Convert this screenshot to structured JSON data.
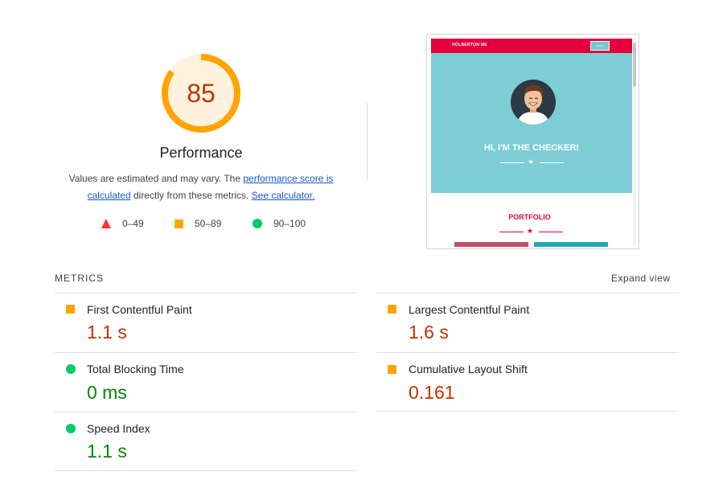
{
  "gauge": {
    "score": "85",
    "score_fraction": 0.85,
    "title": "Performance",
    "color": "#ffa400"
  },
  "note": {
    "text_before": "Values are estimated and may vary. The ",
    "link1": "performance score is calculated",
    "text_mid": " directly from these metrics. ",
    "link2": "See calculator."
  },
  "legend": [
    {
      "icon": "fail-triangle-icon",
      "range": "0–49",
      "color": "#ff3333"
    },
    {
      "icon": "average-square-icon",
      "range": "50–89",
      "color": "#ffa400"
    },
    {
      "icon": "pass-circle-icon",
      "range": "90–100",
      "color": "#00cc66"
    }
  ],
  "screenshot": {
    "brand": "HOLBERTON ME",
    "menu": "MENU",
    "hero_title": "HI, I'M THE CHECKER!",
    "section_title": "PORTFOLIO",
    "nav_color": "#e5003d",
    "hero_color": "#7ccdd4"
  },
  "metrics": {
    "header": "METRICS",
    "expand": "Expand view",
    "items": [
      {
        "label": "First Contentful Paint",
        "value": "1.1 s",
        "status": "average",
        "icon": "average-square-icon"
      },
      {
        "label": "Largest Contentful Paint",
        "value": "1.6 s",
        "status": "average",
        "icon": "average-square-icon"
      },
      {
        "label": "Total Blocking Time",
        "value": "0 ms",
        "status": "pass",
        "icon": "pass-circle-icon"
      },
      {
        "label": "Cumulative Layout Shift",
        "value": "0.161",
        "status": "average",
        "icon": "average-square-icon"
      },
      {
        "label": "Speed Index",
        "value": "1.1 s",
        "status": "pass",
        "icon": "pass-circle-icon"
      }
    ]
  },
  "colors": {
    "average_text": "#c33300",
    "pass_text": "#008800",
    "link": "#1a56c5"
  }
}
